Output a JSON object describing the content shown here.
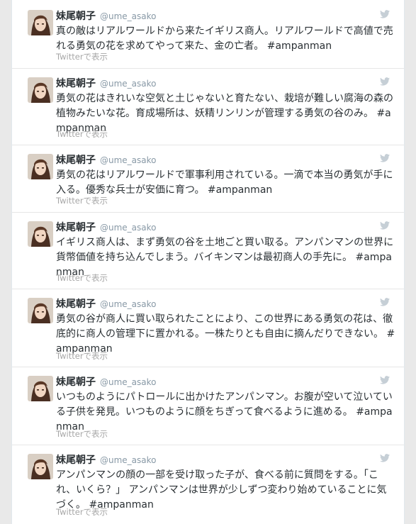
{
  "author": {
    "name": "妹尾朝子",
    "handle": "@ume_asako"
  },
  "view_label": "Twitterで表示",
  "accent_color": "#8899a6",
  "icons": {
    "avatar": "avatar",
    "twitter": "twitter-bird-icon"
  },
  "tweets": [
    {
      "text": "真の敵はリアルワールドから来たイギリス商人。リアルワールドで高値で売れる勇気の花を求めてやって来た、金の亡者。 ",
      "hashtag": "#ampanman"
    },
    {
      "text": "勇気の花はきれいな空気と土じゃないと育たない、栽培が難しい腐海の森の植物みたいな花。育成場所は、妖精リンリンが管理する勇気の谷のみ。 ",
      "hashtag": "#ampanman"
    },
    {
      "text": "勇気の花はリアルワールドで軍事利用されている。一滴で本当の勇気が手に入る。優秀な兵士が安価に育つ。 ",
      "hashtag": "#ampanman"
    },
    {
      "text": "イギリス商人は、まず勇気の谷を土地ごと買い取る。アンパンマンの世界に貨幣価値を持ち込んでしまう。バイキンマンは最初商人の手先に。 ",
      "hashtag": "#ampanman"
    },
    {
      "text": "勇気の谷が商人に買い取られたことにより、この世界にある勇気の花は、徹底的に商人の管理下に置かれる。一株たりとも自由に摘んだりできない。 ",
      "hashtag": "#ampanman"
    },
    {
      "text": "いつものようにパトロールに出かけたアンパンマン。お腹が空いて泣いている子供を発見。いつものように顔をちぎって食べるように進める。 ",
      "hashtag": "#ampanman"
    },
    {
      "text": "アンパンマンの顔の一部を受け取った子が、食べる前に質問をする。「これ、いくら？」 アンパンマンは世界が少しずつ変わり始めていることに気づく。 ",
      "hashtag": "#ampanman"
    }
  ]
}
